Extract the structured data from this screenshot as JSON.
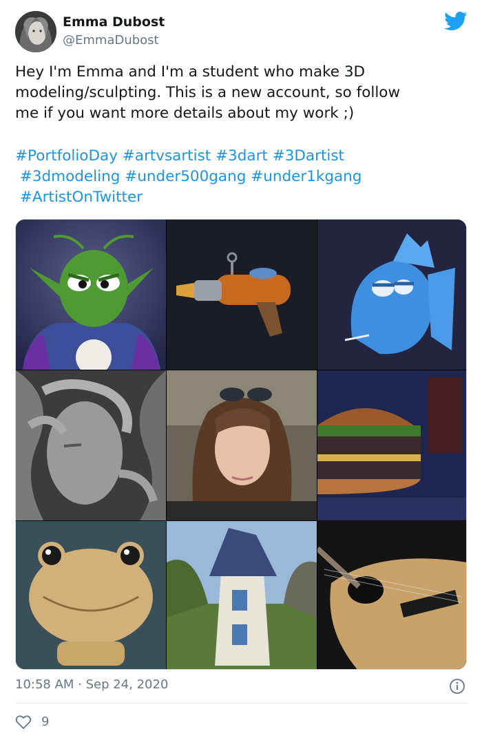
{
  "user": {
    "display_name": "Emma Dubost",
    "handle": "@EmmaDubost"
  },
  "tweet": {
    "text_lines": [
      "Hey I'm Emma and I'm a student who make 3D",
      "modeling/sculpting. This is a new account, so follow",
      "me if you want more details about my work ;)"
    ],
    "hashtags": [
      "#PortfolioDay",
      "#artvsartist",
      "#3dart",
      "#3Dartist",
      "#3dmodeling",
      "#under500gang",
      "#under1kgang",
      "#ArtistOnTwitter"
    ],
    "timestamp": "10:58 AM · Sep 24, 2020",
    "likes": "9"
  },
  "colors": {
    "link": "#1b95e0",
    "brand": "#1da1f2",
    "muted": "#657786"
  },
  "icons": {
    "logo": "twitter-bird-icon",
    "info": "info-icon",
    "like": "heart-icon"
  }
}
